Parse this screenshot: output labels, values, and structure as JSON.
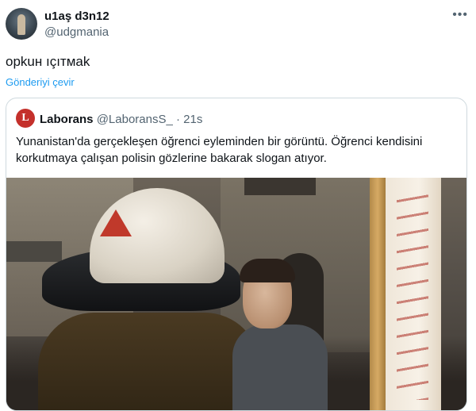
{
  "tweet": {
    "display_name": "u1aş d3n12",
    "handle": "@udgmania",
    "text": "орkuн ıçıтмаk",
    "translate_label": "Gönderiyi çevir",
    "more_icon": "more-horizontal-icon"
  },
  "quoted": {
    "avatar_letter": "L",
    "name": "Laborans",
    "handle": "@LaboransS_",
    "separator": "·",
    "time": "21s",
    "text": "Yunanistan'da gerçekleşen öğrenci eyleminden bir görüntü. Öğrenci kendisini korkutmaya çalışan polisin gözlerine bakarak slogan atıyor."
  },
  "colors": {
    "link": "#1d9bf0",
    "secondary_text": "#536471",
    "brand_avatar": "#c4302b"
  }
}
